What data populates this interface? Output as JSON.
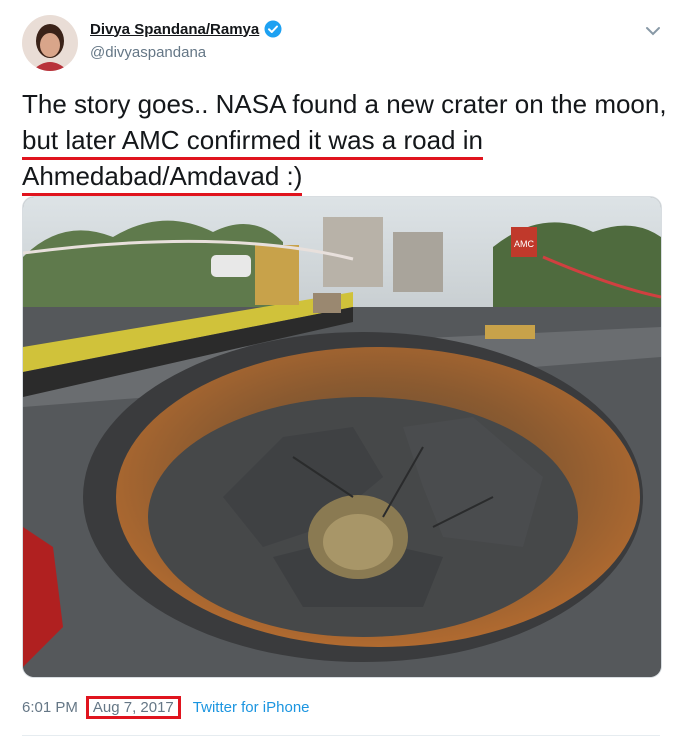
{
  "tweet": {
    "author_name": "Divya Spandana/Ramya",
    "handle": "@divyaspandana",
    "text_part1": "The story goes.. NASA found a new crater on the moon,",
    "text_part2": "but later AMC confirmed it was a road in",
    "text_part3": "Ahmedabad/Amdavad :)",
    "time": "6:01 PM",
    "date": "Aug 7, 2017",
    "source": "Twitter for iPhone"
  },
  "photo": {
    "sign_text": "AMC"
  },
  "colors": {
    "link": "#1b95e0",
    "verified": "#1da1f2",
    "highlight": "#e0141e",
    "muted": "#657786"
  }
}
